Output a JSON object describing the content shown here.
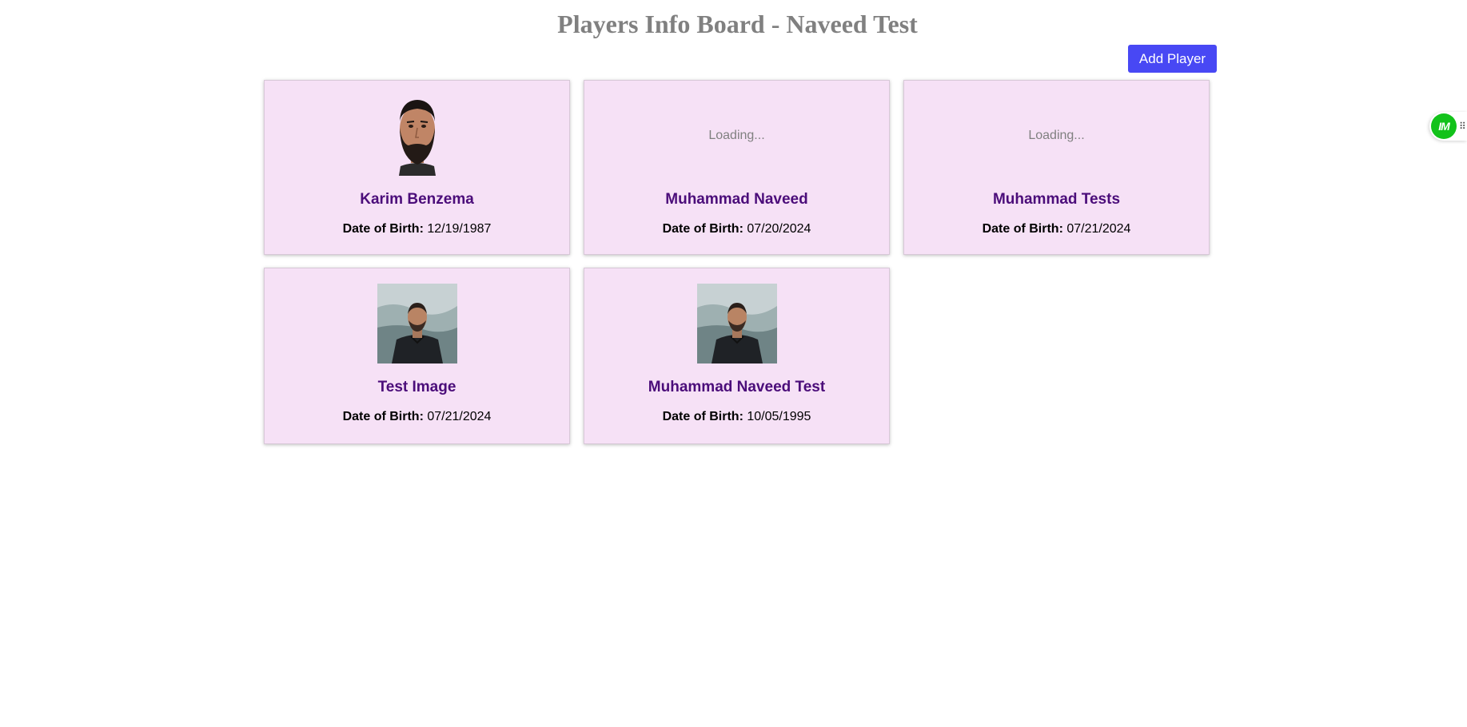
{
  "header": {
    "title": "Players Info Board - Naveed Test",
    "add_button_label": "Add Player"
  },
  "dob_label": "Date of Birth:",
  "players": [
    {
      "name": "Karim Benzema",
      "dob": "12/19/1987",
      "image": "photo-bearded-man"
    },
    {
      "name": "Muhammad Naveed",
      "dob": "07/20/2024",
      "image": "loading",
      "loading_text": "Loading..."
    },
    {
      "name": "Muhammad Tests",
      "dob": "07/21/2024",
      "image": "loading",
      "loading_text": "Loading..."
    },
    {
      "name": "Test Image",
      "dob": "07/21/2024",
      "image": "photo-man-jacket"
    },
    {
      "name": "Muhammad Naveed Test",
      "dob": "10/05/1995",
      "image": "photo-man-jacket"
    }
  ],
  "extension": {
    "badge_text": "IM",
    "handle_glyph": "⠿"
  },
  "colors": {
    "card_bg": "#f6e1f6",
    "name_color": "#4b0d7a",
    "button_bg": "#4848f4",
    "title_color": "#808080"
  }
}
